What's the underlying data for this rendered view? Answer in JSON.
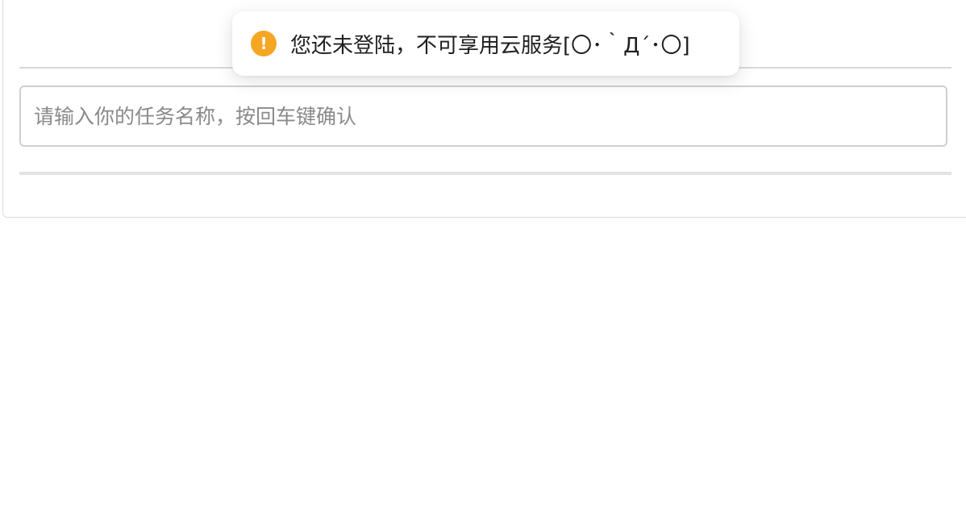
{
  "toast": {
    "icon": "warning-icon",
    "icon_glyph": "!",
    "message": "您还未登陆，不可享用云服务[〇･｀Д´･〇]",
    "accent_color": "#f5a623"
  },
  "task_input": {
    "placeholder": "请输入你的任务名称，按回车键确认",
    "value": ""
  }
}
